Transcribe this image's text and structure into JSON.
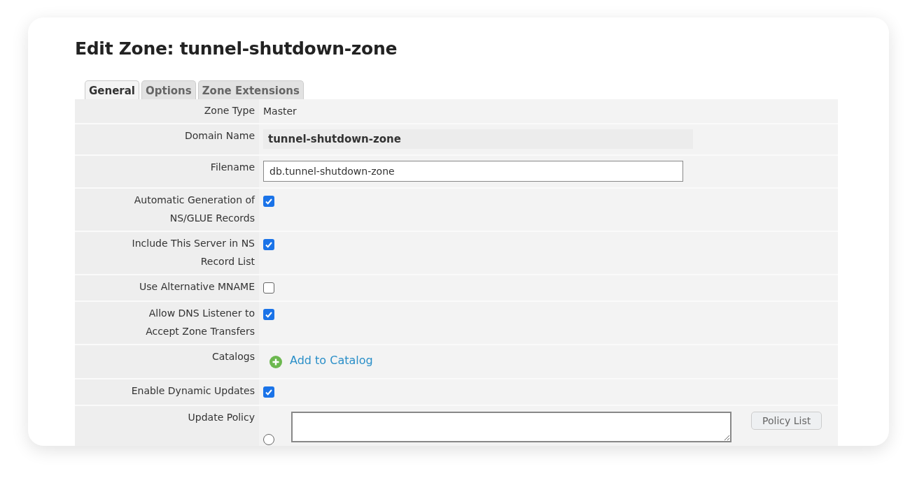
{
  "title": "Edit Zone: tunnel-shutdown-zone",
  "tabs": [
    {
      "label": "General",
      "selected": true
    },
    {
      "label": "Options",
      "selected": false
    },
    {
      "label": "Zone Extensions",
      "selected": false
    }
  ],
  "rows": [
    {
      "kind": "text",
      "label": "Zone Type",
      "value": "Master"
    },
    {
      "kind": "static",
      "label": "Domain Name",
      "value": "tunnel-shutdown-zone"
    },
    {
      "kind": "input",
      "label": "Filename",
      "value": "db.tunnel-shutdown-zone"
    },
    {
      "kind": "checkbox",
      "label": "Automatic Generation of NS/GLUE Records",
      "checked": true
    },
    {
      "kind": "checkbox",
      "label": "Include This Server in NS Record List",
      "checked": true
    },
    {
      "kind": "checkbox",
      "label": "Use Alternative MNAME",
      "checked": false
    },
    {
      "kind": "checkbox",
      "label": "Allow DNS Listener to Accept Zone Transfers",
      "checked": true
    },
    {
      "kind": "link",
      "label": "Catalogs",
      "value": "Add to Catalog"
    },
    {
      "kind": "checkbox",
      "label": "Enable Dynamic Updates",
      "checked": true
    },
    {
      "kind": "policy",
      "label": "Update Policy",
      "selected": false,
      "button": "Policy List"
    }
  ]
}
